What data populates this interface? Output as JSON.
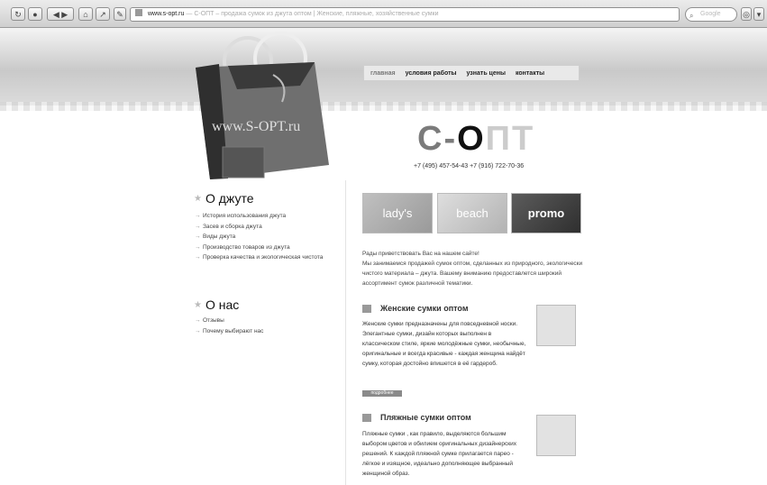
{
  "browser": {
    "url": "www.s-opt.ru",
    "tab_title": "— С-ОПТ – продажа сумок из джута оптом | Женские, пляжные, хозяйственные сумки",
    "search_placeholder": "Google",
    "search_icon": "magnifier"
  },
  "nav": {
    "items": [
      "главная",
      "условия работы",
      "узнать цены",
      "контакты"
    ]
  },
  "logo": {
    "part1": "С-",
    "part2": "О",
    "part3": "ПТ",
    "bag_text": "www.S-OPT.ru"
  },
  "contacts": {
    "phones": "+7 (495) 457-54-43   +7 (916) 722-70-36"
  },
  "sidebar": {
    "about_jute": {
      "title": "О джуте",
      "items": [
        "История использования джута",
        "Засев и сборка джута",
        "Виды джута",
        "Производство товаров из джута",
        "Проверка качества и экологическая чистота"
      ]
    },
    "about_us": {
      "title": "О нас",
      "items": [
        "Отзывы",
        "Почему выбирают нас"
      ]
    }
  },
  "promos": [
    "lady's",
    "beach",
    "promo"
  ],
  "intro": {
    "greeting": "Рады приветствовать Вас на нашем сайте!",
    "text": "Мы занимаемся продажей сумок оптом, сделанных из природного, экологически чистого материала – джута. Вашему вниманию предоставлется широкий ассортимент сумок различной тематики."
  },
  "sections": [
    {
      "title": "Женские сумки оптом",
      "text": "Женские сумки предназначены для повседневной носки. Элегантные сумки, дизайн которых выполнен в классическом стиле, яркие молодёжные сумки, необычные, оригинальные и всегда красивые - каждая женщина найдёт сумку, которая достойно впишется в её гардероб.",
      "more": "подробнее"
    },
    {
      "title": "Пляжные сумки оптом",
      "text": "Пляжные сумки , как правило, выделяются большим выбором цветов и обилием оригинальных дизайнерских решений. К каждой пляжной сумке прилагается парео - лёгкое и изящное, идеально дополняющее выбранный женщиной образ."
    }
  ]
}
